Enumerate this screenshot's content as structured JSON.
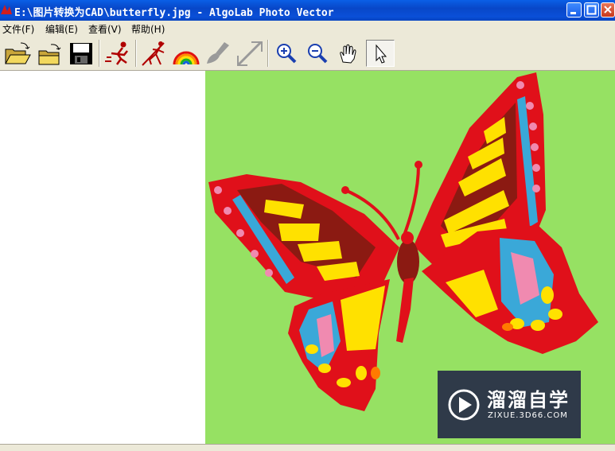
{
  "window": {
    "title": "E:\\图片转换为CAD\\butterfly.jpg - AlgoLab Photo Vector"
  },
  "menu": {
    "items": [
      "文件(F)",
      "编辑(E)",
      "查看(V)",
      "帮助(H)"
    ]
  },
  "toolbar": {
    "buttons": [
      {
        "icon": "open-folder-icon"
      },
      {
        "icon": "save-as-icon"
      },
      {
        "icon": "save-disk-icon"
      },
      {
        "icon": "run-vectorize-icon"
      },
      {
        "icon": "stick-figure-icon"
      },
      {
        "icon": "rainbow-icon"
      },
      {
        "icon": "brush-icon"
      },
      {
        "icon": "line-diagonal-icon"
      },
      {
        "icon": "zoom-in-icon"
      },
      {
        "icon": "zoom-out-icon"
      },
      {
        "icon": "hand-pan-icon"
      },
      {
        "icon": "arrow-pointer-icon"
      }
    ]
  },
  "colors": {
    "canvas_bg": "#96e163",
    "wing_red": "#e0101a",
    "wing_dark": "#8b1a12",
    "yellow": "#ffe100",
    "blue": "#3aa8d8",
    "pink": "#f08ab0"
  },
  "watermark": {
    "cn": "溜溜自学",
    "url": "ZIXUE.3D66.COM"
  }
}
